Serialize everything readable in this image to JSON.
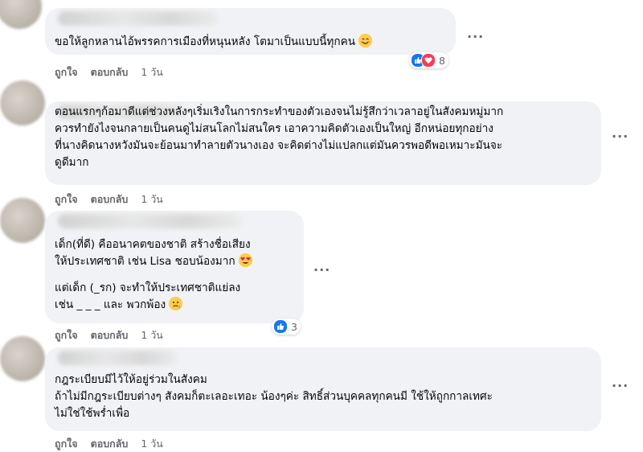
{
  "comments": [
    {
      "text": "ขอให้ลูกหลานไอ้พรรคการเมืองที่หนุนหลัง โตมาเป็นแบบนี้ทุกคน",
      "emoji": "smiling-face-icon",
      "reactions": {
        "icons": [
          "like-icon",
          "love-icon"
        ],
        "count": "8"
      },
      "actions": {
        "like": "ถูกใจ",
        "reply": "ตอบกลับ",
        "time": "1 วัน"
      }
    },
    {
      "text": "ตอนแรกๆก้อมาดีแต่ช่วงหลังๆเริ่มเริงในการกระทำของตัวเองจนไม่รู้สึกว่าเวลาอยู่ในสังคมหมู่มาก\nควรทำยังไงจนกลายเป็นคนดูไม่สนโลกไม่สนใคร เอาความคิดตัวเองเป็นใหญ่ อีกหน่อยทุกอย่าง\nที่นางคิดนางหวังมันจะย้อนมาทำลายตัวนางเอง จะคิดต่างไม่แปลกแต่มันควรพอดีพอเหมาะมันจะ\nดูดีมาก",
      "actions": {
        "like": "ถูกใจ",
        "reply": "ตอบกลับ",
        "time": "1 วัน"
      }
    },
    {
      "text_line1": "เด็ก(ที่ดี) คืออนาคตของชาติ สร้างชื่อเสียง",
      "text_line2": "ให้ประเทศชาติ เช่น Lisa ชอบน้องมาก",
      "text_line3": "แต่เด็ก (_รก) จะทำให้ประเทศชาติแย่ลง",
      "text_line4": "เช่น _ _ _ และ พวกพ้อง",
      "emoji1": "heart-eyes-icon",
      "emoji2": "worried-face-icon",
      "reactions": {
        "icons": [
          "like-icon"
        ],
        "count": "3"
      },
      "actions": {
        "like": "ถูกใจ",
        "reply": "ตอบกลับ",
        "time": "1 วัน"
      }
    },
    {
      "text": "กฎระเบียบมีไว้ให้อยู่ร่วมในสังคม\nถ้าไม่มีกฎระเบียบต่างๆ สังคมก็ตะเลอะเทอะ น้องๆค่ะ สิทธิ์ส่วนบุคคลทุกคนมี ใช้ให้ถูกกาลเทศะ\nไม่ใช่ใช้พร่ำเพื่อ",
      "actions": {
        "like": "ถูกใจ",
        "reply": "ตอบกลับ",
        "time": "1 วัน"
      }
    }
  ],
  "more_label": "···"
}
